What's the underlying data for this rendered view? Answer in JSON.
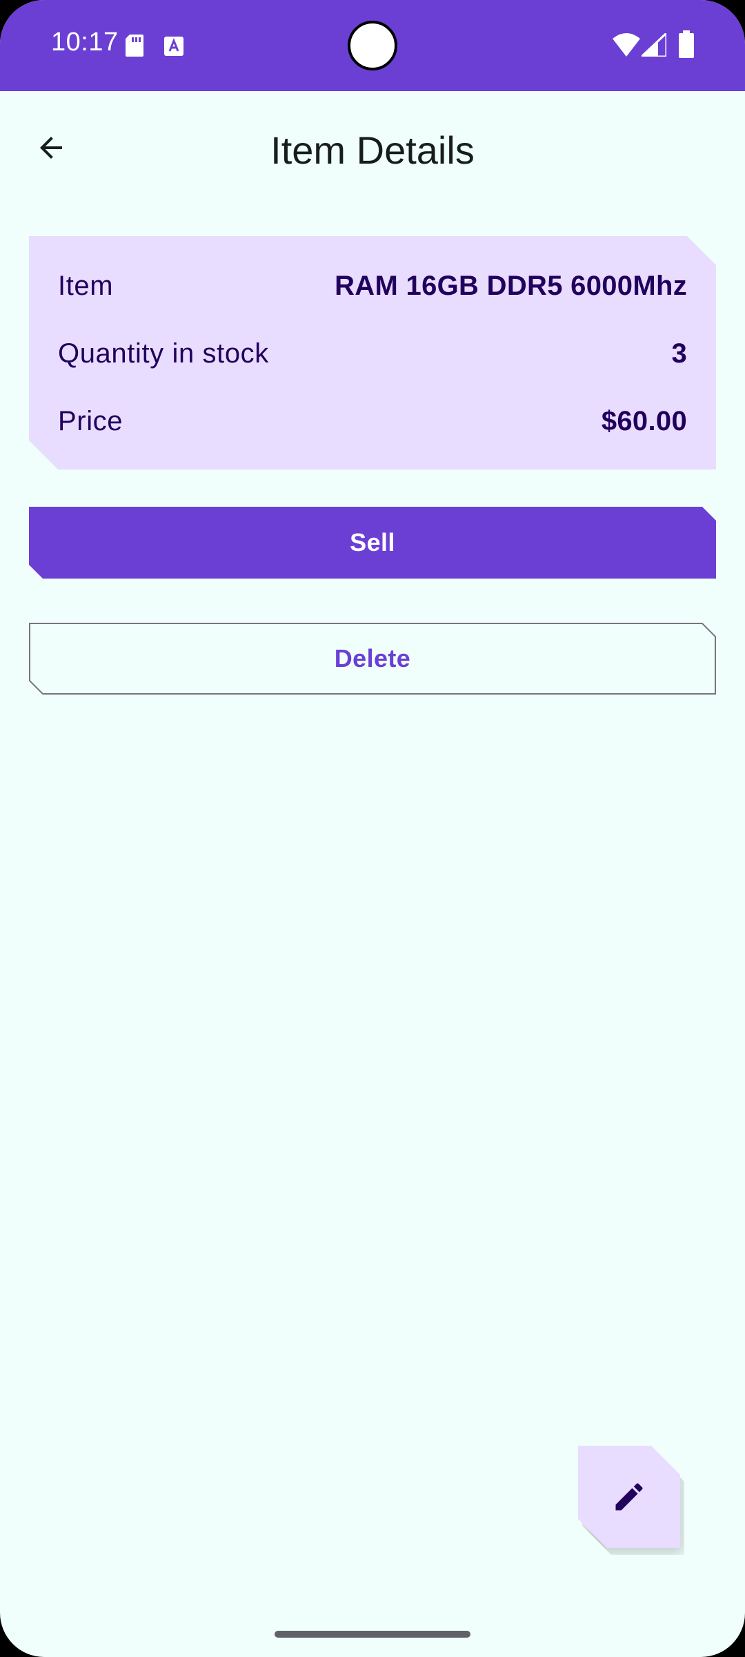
{
  "status_bar": {
    "time": "10:17",
    "icons": [
      "sd-card-icon",
      "a-notification-icon",
      "wifi-icon",
      "signal-icon",
      "battery-icon"
    ],
    "color": "#6B3FD4"
  },
  "top_bar": {
    "back_icon": "arrow-back-icon",
    "title": "Item Details"
  },
  "details_card": {
    "rows": [
      {
        "label": "Item",
        "value": "RAM 16GB DDR5 6000Mhz"
      },
      {
        "label": "Quantity in stock",
        "value": "3"
      },
      {
        "label": "Price",
        "value": "$60.00"
      }
    ],
    "background": "#E8DDFE"
  },
  "actions": {
    "sell_label": "Sell",
    "delete_label": "Delete"
  },
  "fab": {
    "icon": "edit-pencil-icon"
  },
  "colors": {
    "primary": "#6B3FD4",
    "background": "#F0FEFC",
    "on_container": "#22005D",
    "container": "#E8DDFE"
  }
}
